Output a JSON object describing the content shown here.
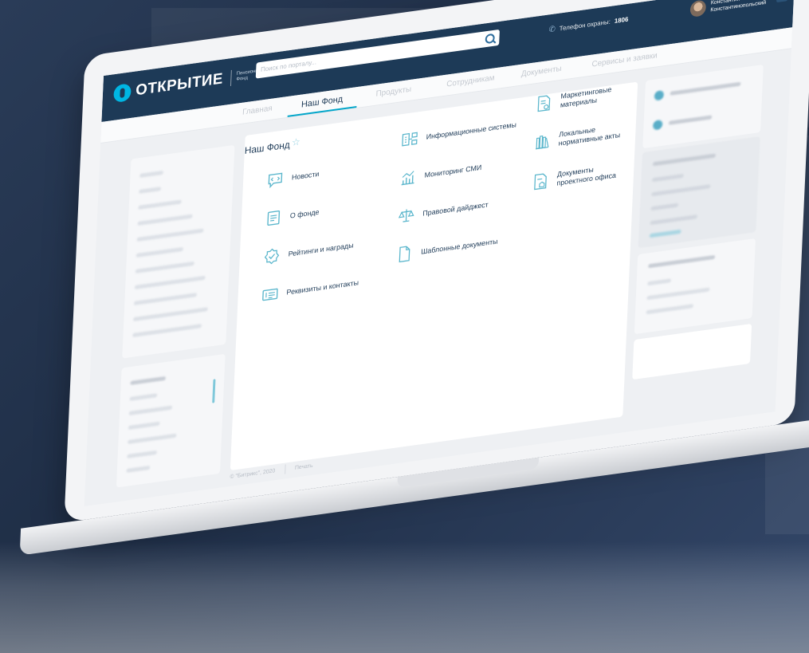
{
  "header": {
    "logo_text": "ОТКРЫТИЕ",
    "logo_subtitle": "Пенсионный Фонд",
    "search_placeholder": "Поиск по порталу...",
    "phone_label": "Телефон охраны:",
    "phone_number": "1806",
    "user_name_first": "Константин",
    "user_name_last": "Константинопольский"
  },
  "tabs": {
    "items": [
      "Главная",
      "Наш Фонд",
      "Продукты",
      "Сотрудникам",
      "Документы",
      "Сервисы и заявки"
    ],
    "active_index": 1
  },
  "main": {
    "title": "Наш Фонд",
    "col1": [
      {
        "label": "Новости",
        "icon": "news-icon"
      },
      {
        "label": "О фонде",
        "icon": "about-icon"
      },
      {
        "label": "Рейтинги и награды",
        "icon": "award-icon"
      },
      {
        "label": "Реквизиты и контакты",
        "icon": "contacts-icon"
      }
    ],
    "col2": [
      {
        "label": "Информационные системы",
        "icon": "systems-icon"
      },
      {
        "label": "Мониторинг СМИ",
        "icon": "monitoring-icon"
      },
      {
        "label": "Правовой дайджест",
        "icon": "legal-icon"
      },
      {
        "label": "Шаблонные документы",
        "icon": "template-doc-icon"
      }
    ],
    "col3": [
      {
        "label": "Маркетинговые материалы",
        "icon": "marketing-icon"
      },
      {
        "label": "Локальные нормативные акты",
        "icon": "regulations-icon"
      },
      {
        "label": "Документы проектного офиса",
        "icon": "project-docs-icon"
      }
    ]
  },
  "footer": {
    "copyright": "© \"Битрикс\", 2020",
    "print": "Печать"
  },
  "colors": {
    "navy": "#1d3a57",
    "accent": "#00a5c9",
    "icon": "#5ab6cc"
  }
}
